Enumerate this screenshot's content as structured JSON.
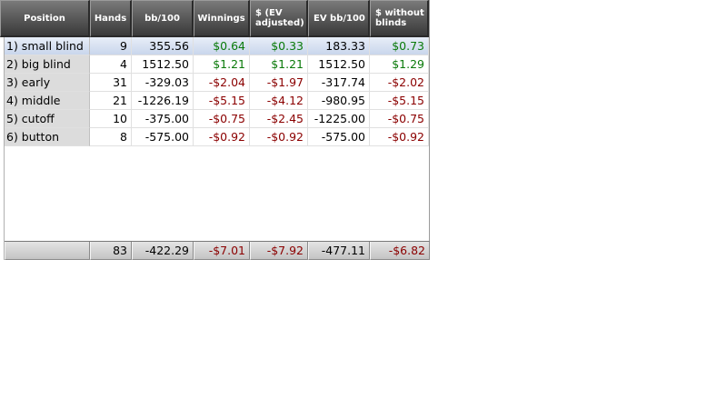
{
  "columns": [
    {
      "key": "position",
      "label": "Position",
      "align": "c"
    },
    {
      "key": "hands",
      "label": "Hands",
      "align": "c"
    },
    {
      "key": "bb100",
      "label": "bb/100",
      "align": "c"
    },
    {
      "key": "winnings",
      "label": "Winnings",
      "align": "c"
    },
    {
      "key": "ev_adj",
      "label": "$ (EV adjusted)",
      "align": "l"
    },
    {
      "key": "ev_bb100",
      "label": "EV bb/100",
      "align": "l"
    },
    {
      "key": "without_blinds",
      "label": "$ without blinds",
      "align": "l"
    }
  ],
  "rows": [
    {
      "position": "1) small blind",
      "hands": "9",
      "bb100": "355.56",
      "winnings": "$0.64",
      "ev_adj": "$0.33",
      "ev_bb100": "183.33",
      "without_blinds": "$0.73",
      "selected": true
    },
    {
      "position": "2) big blind",
      "hands": "4",
      "bb100": "1512.50",
      "winnings": "$1.21",
      "ev_adj": "$1.21",
      "ev_bb100": "1512.50",
      "without_blinds": "$1.29"
    },
    {
      "position": "3) early",
      "hands": "31",
      "bb100": "-329.03",
      "winnings": "-$2.04",
      "ev_adj": "-$1.97",
      "ev_bb100": "-317.74",
      "without_blinds": "-$2.02"
    },
    {
      "position": "4) middle",
      "hands": "21",
      "bb100": "-1226.19",
      "winnings": "-$5.15",
      "ev_adj": "-$4.12",
      "ev_bb100": "-980.95",
      "without_blinds": "-$5.15"
    },
    {
      "position": "5) cutoff",
      "hands": "10",
      "bb100": "-375.00",
      "winnings": "-$0.75",
      "ev_adj": "-$2.45",
      "ev_bb100": "-1225.00",
      "without_blinds": "-$0.75"
    },
    {
      "position": "6) button",
      "hands": "8",
      "bb100": "-575.00",
      "winnings": "-$0.92",
      "ev_adj": "-$0.92",
      "ev_bb100": "-575.00",
      "without_blinds": "-$0.92"
    }
  ],
  "totals": {
    "position": "",
    "hands": "83",
    "bb100": "-422.29",
    "winnings": "-$7.01",
    "ev_adj": "-$7.92",
    "ev_bb100": "-477.11",
    "without_blinds": "-$6.82"
  },
  "colors": {
    "positive": "#0a7a0a",
    "negative": "#8b0000",
    "header": "#4a4a4a",
    "selected": "#c9d6ec"
  }
}
